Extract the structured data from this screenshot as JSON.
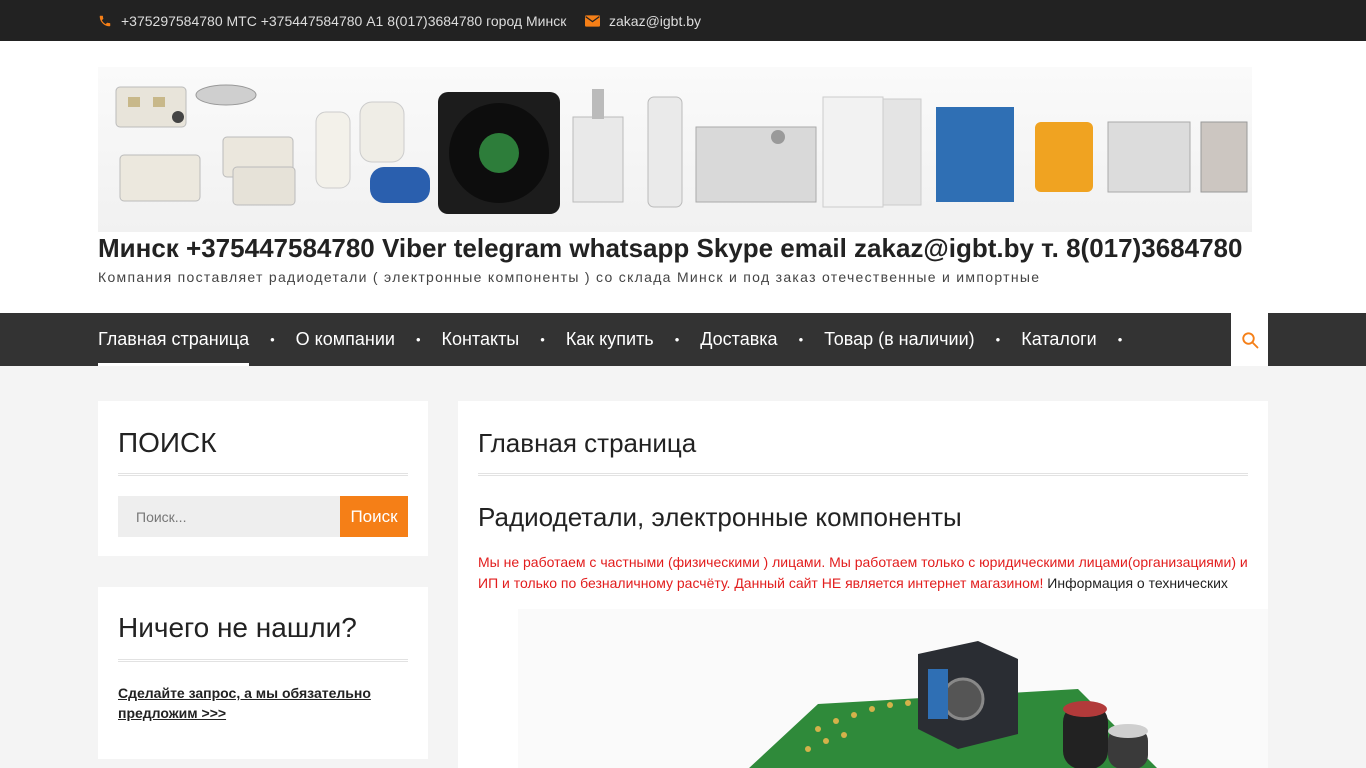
{
  "topbar": {
    "phone_icon": "phone-icon",
    "phones": "+375297584780 МТС +375447584780 А1 8(017)3684780 город Минск",
    "mail_icon": "envelope-icon",
    "email": "zakaz@igbt.by"
  },
  "header": {
    "banner_icon": "electronic-components-banner",
    "site_title": "Минск +375447584780 Viber telegram whatsapp Skype email zakaz@igbt.by т. 8(017)3684780",
    "site_description": "Компания поставляет радиодетали ( электронные компоненты ) со склада Минск и под заказ отечественные и импортные"
  },
  "nav": {
    "items": [
      {
        "label": "Главная страница"
      },
      {
        "label": "О компании"
      },
      {
        "label": "Контакты"
      },
      {
        "label": "Как купить"
      },
      {
        "label": "Доставка"
      },
      {
        "label": "Товар (в наличии)"
      },
      {
        "label": "Каталоги"
      }
    ],
    "separator": "•",
    "search_icon": "search-icon"
  },
  "sidebar": {
    "search_widget": {
      "title": "ПОИСК",
      "placeholder": "Поиск...",
      "button_label": "Поиск"
    },
    "notfound_widget": {
      "title": "Ничего не нашли?",
      "link_text": "Сделайте запрос, а мы обязательно предложим >>>"
    }
  },
  "main": {
    "page_title": "Главная страница",
    "heading": "Радиодетали, электронные компоненты",
    "notice_red": "Мы не работаем с частными (физическими ) лицами. Мы работаем только с юридическими лицами(организациями) и ИП и только по безналичному расчёту. Данный сайт НЕ является интернет магазином!",
    "notice_black": " Информация о технических",
    "image_icon": "electronic-board-photo"
  },
  "colors": {
    "accent": "#f57f17",
    "topbar_bg": "#222222",
    "nav_bg": "#333333",
    "notice_red": "#e21d1d"
  }
}
